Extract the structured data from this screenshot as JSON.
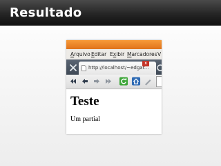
{
  "slide": {
    "title": "Resultado"
  },
  "browser": {
    "menu": [
      {
        "pre": "",
        "key": "A",
        "post": "rquivo"
      },
      {
        "pre": "",
        "key": "E",
        "post": "ditar"
      },
      {
        "pre": "E",
        "key": "x",
        "post": "ibir"
      },
      {
        "pre": "",
        "key": "M",
        "post": "arcadores"
      },
      {
        "pre": "",
        "key": "",
        "post": "V"
      }
    ],
    "tab_close_label": "x",
    "tab_url": "http://localhost/~edgar...",
    "nav_icons": [
      "rewind-icon",
      "back-icon",
      "forward-icon",
      "fast-forward-icon",
      "reload-icon",
      "home-icon",
      "edit-icon"
    ]
  },
  "page": {
    "heading": "Teste",
    "text": "Um partial"
  }
}
